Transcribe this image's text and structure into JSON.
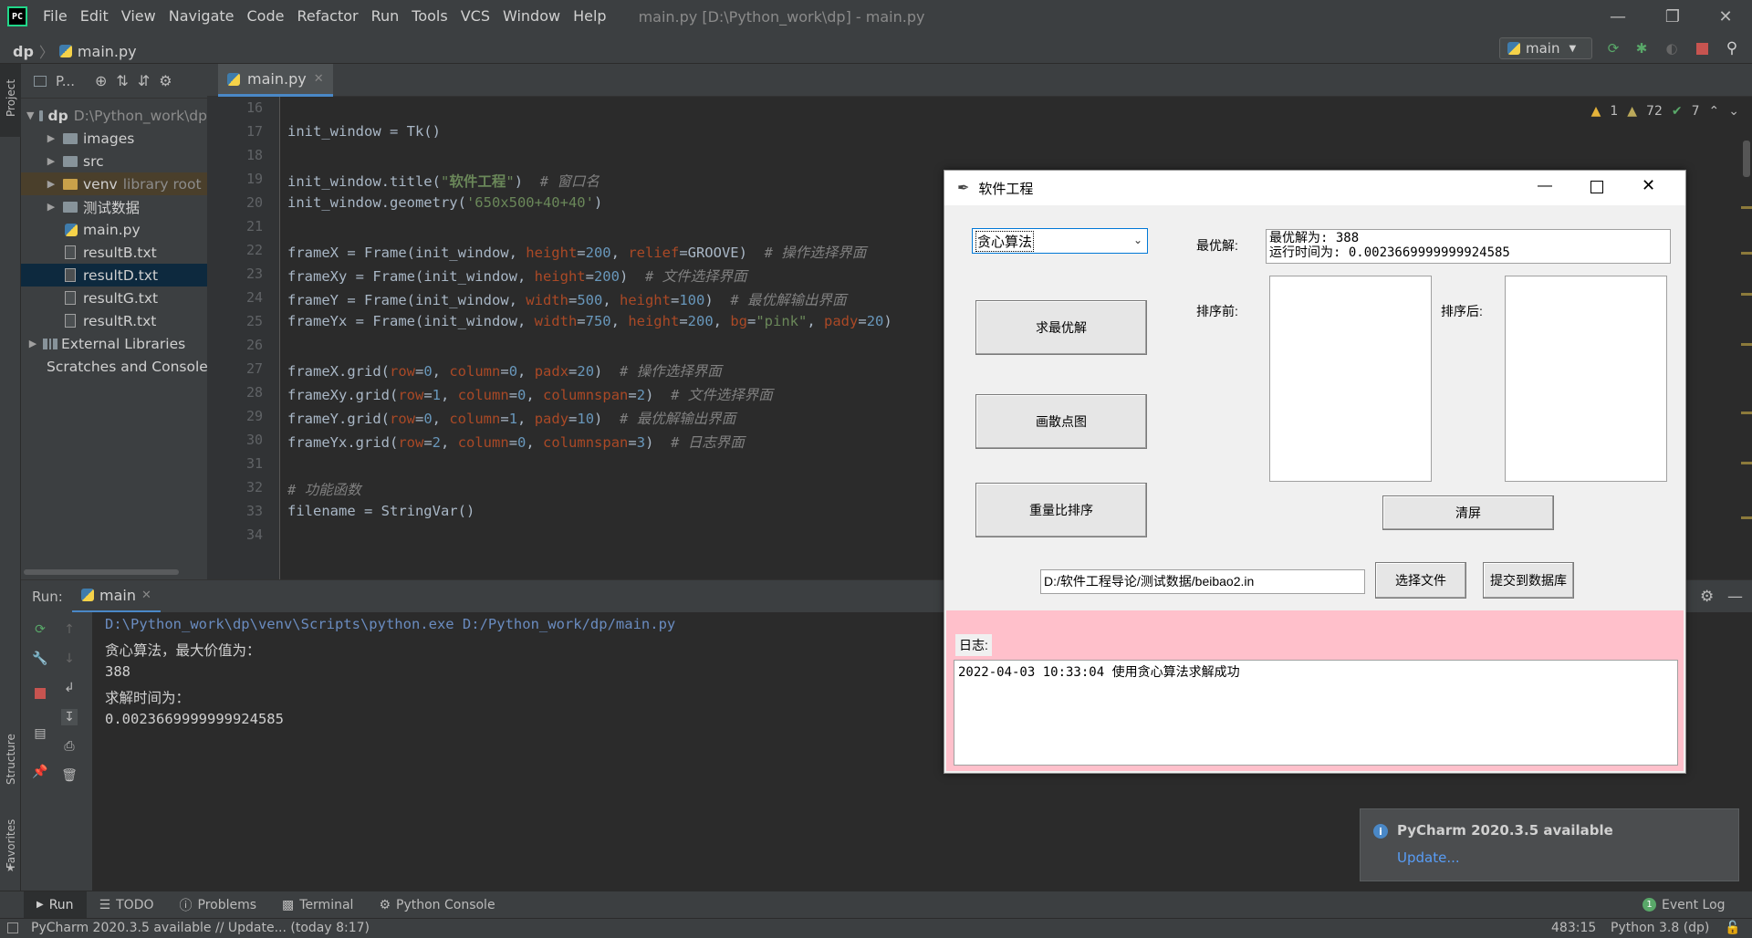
{
  "menu": {
    "items": [
      "File",
      "Edit",
      "View",
      "Navigate",
      "Code",
      "Refactor",
      "Run",
      "Tools",
      "VCS",
      "Window",
      "Help"
    ],
    "window_title": "main.py [D:\\Python_work\\dp] - main.py"
  },
  "nav": {
    "project": "dp",
    "file": "main.py",
    "run_config": "main"
  },
  "project_panel": {
    "title": "P...",
    "tree": [
      {
        "label": "dp",
        "hint": "D:\\Python_work\\dp",
        "type": "folder",
        "level": 0,
        "expanded": true
      },
      {
        "label": "images",
        "type": "folder",
        "level": 1
      },
      {
        "label": "src",
        "type": "folder",
        "level": 1
      },
      {
        "label": "venv",
        "hint": "library root",
        "type": "folder",
        "level": 1
      },
      {
        "label": "测试数据",
        "type": "folder",
        "level": 1
      },
      {
        "label": "main.py",
        "type": "py",
        "level": 1
      },
      {
        "label": "resultB.txt",
        "type": "file",
        "level": 1
      },
      {
        "label": "resultD.txt",
        "type": "file",
        "level": 1,
        "selected": true
      },
      {
        "label": "resultG.txt",
        "type": "file",
        "level": 1
      },
      {
        "label": "resultR.txt",
        "type": "file",
        "level": 1
      },
      {
        "label": "External Libraries",
        "type": "lib",
        "level": 0
      },
      {
        "label": "Scratches and Consoles",
        "type": "scratch",
        "level": 0
      }
    ]
  },
  "editor": {
    "tab": "main.py",
    "line_numbers": [
      "16",
      "17",
      "18",
      "19",
      "20",
      "21",
      "22",
      "23",
      "24",
      "25",
      "26",
      "27",
      "28",
      "29",
      "30",
      "31",
      "32",
      "33",
      "34"
    ],
    "inspections": {
      "errors": "1",
      "warnings": "72",
      "ok": "7"
    }
  },
  "run_panel": {
    "label": "Run:",
    "tab": "main",
    "console": [
      "D:\\Python_work\\dp\\venv\\Scripts\\python.exe D:/Python_work/dp/main.py",
      "贪心算法，最大价值为：",
      "388",
      "求解时间为：",
      "0.0023669999999924585"
    ]
  },
  "tk_app": {
    "title": "软件工程",
    "algorithm_selected": "贪心算法",
    "buttons": {
      "solve": "求最优解",
      "scatter": "画散点图",
      "sort": "重量比排序",
      "clear": "清屏",
      "choose_file": "选择文件",
      "submit": "提交到数据库"
    },
    "labels": {
      "best": "最优解:",
      "before": "排序前:",
      "after": "排序后:",
      "log": "日志:"
    },
    "best_text": [
      "最优解为: 388",
      "运行时间为: 0.0023669999999924585"
    ],
    "file_path": "D:/软件工程导论/测试数据/beibao2.in",
    "log_text": "2022-04-03 10:33:04 使用贪心算法求解成功"
  },
  "notification": {
    "title": "PyCharm 2020.3.5 available",
    "link": "Update..."
  },
  "bottom_tabs": [
    "Run",
    "TODO",
    "Problems",
    "Terminal",
    "Python Console"
  ],
  "event_log": "Event Log",
  "event_count": "1",
  "status": {
    "message": "PyCharm 2020.3.5 available // Update... (today 8:17)",
    "position": "483:15",
    "interpreter": "Python 3.8 (dp)"
  },
  "side_labels": {
    "project": "Project",
    "structure": "Structure",
    "favorites": "Favorites"
  },
  "colors": {
    "accent": "#4a88c7",
    "pink": "#ffc0cb",
    "selection": "#0d293e"
  }
}
